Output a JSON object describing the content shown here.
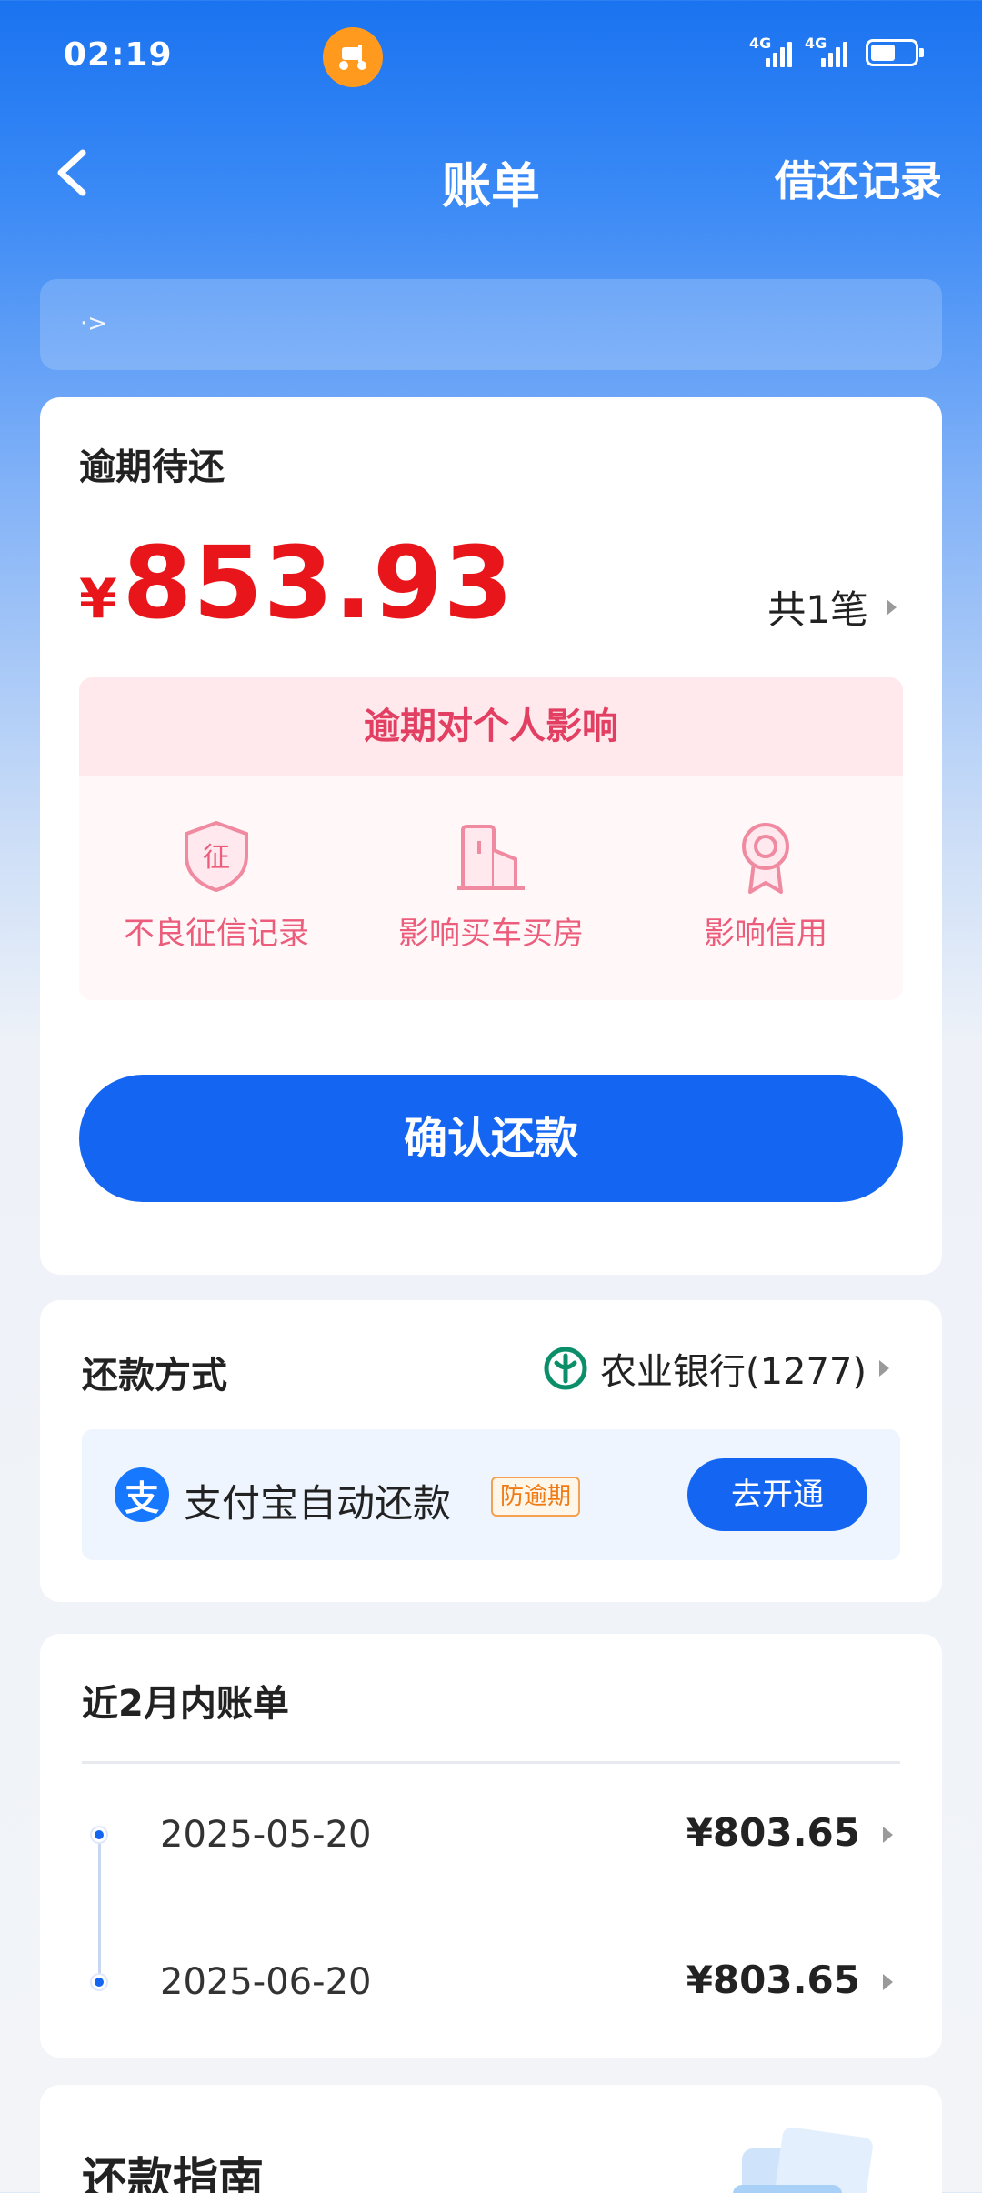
{
  "status_bar": {
    "time": "02:19",
    "signal1": "4G",
    "signal2": "4G"
  },
  "nav": {
    "title": "账单",
    "right_link": "借还记录"
  },
  "notice": {
    "text": "·>"
  },
  "overdue": {
    "title": "逾期待还",
    "currency": "¥",
    "amount": "853.93",
    "count": "共1笔",
    "impact_title": "逾期对个人影响",
    "impact_items": [
      {
        "icon": "credit-shield-icon",
        "label": "不良征信记录",
        "glyph": "征"
      },
      {
        "icon": "building-icon",
        "label": "影响买车买房"
      },
      {
        "icon": "award-ribbon-icon",
        "label": "影响信用"
      }
    ],
    "confirm_label": "确认还款"
  },
  "payment_method": {
    "title": "还款方式",
    "bank": "农业银行(1277)",
    "alipay_text": "支付宝自动还款",
    "alipay_badge": "防逾期",
    "open_label": "去开通"
  },
  "bills": {
    "title": "近2月内账单",
    "rows": [
      {
        "date": "2025-05-20",
        "amount": "¥803.65"
      },
      {
        "date": "2025-06-20",
        "amount": "¥803.65"
      }
    ]
  },
  "guide": {
    "title": "还款指南"
  },
  "colors": {
    "primary": "#1466f2",
    "overdue_red": "#e8161b",
    "impact_pink": "#ec5d7c"
  }
}
